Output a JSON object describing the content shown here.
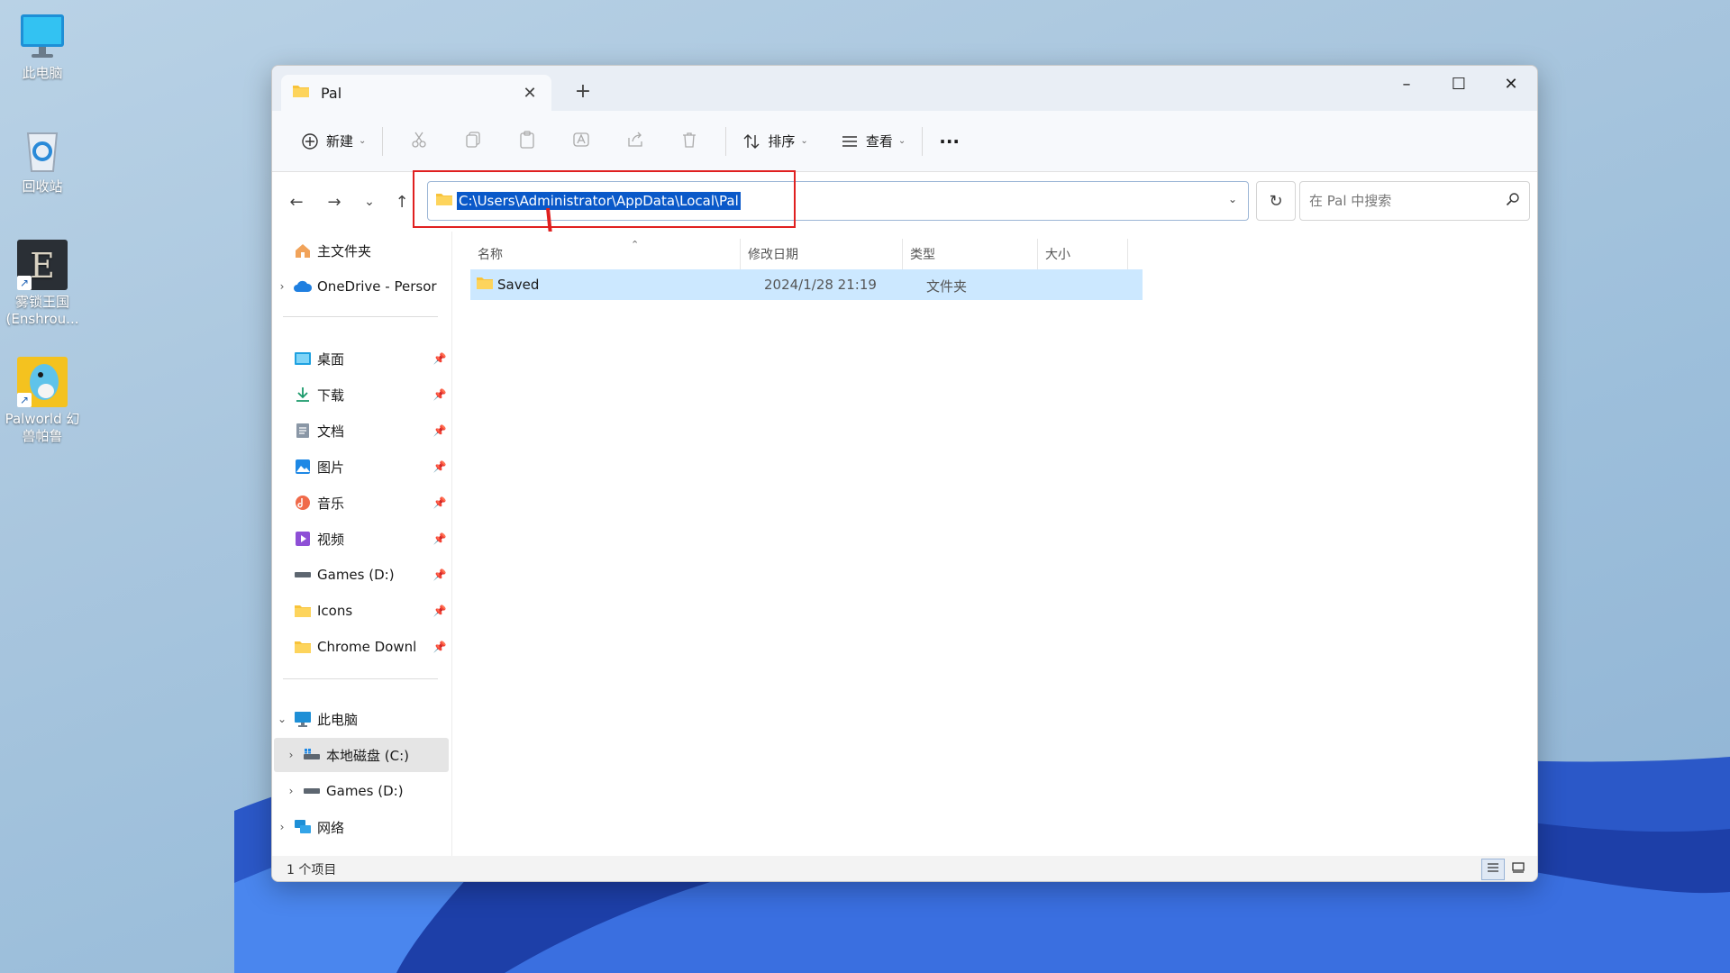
{
  "desktop": {
    "icons": [
      {
        "label": "此电脑",
        "icon": "monitor-icon"
      },
      {
        "label": "回收站",
        "icon": "recycle-bin-icon"
      },
      {
        "label": "雾锁王国 (Enshrou...",
        "icon": "enshrouded-game-icon"
      },
      {
        "label": "Palworld 幻兽帕鲁",
        "icon": "palworld-game-icon"
      }
    ]
  },
  "window": {
    "tab_title": "Pal",
    "new_tab": "+",
    "controls": {
      "minimize": "–",
      "maximize": "☐",
      "close": "✕"
    }
  },
  "toolbar": {
    "new_label": "新建",
    "sort_label": "排序",
    "view_label": "查看",
    "more_label": "···"
  },
  "address_bar": {
    "path": "C:\\Users\\Administrator\\AppData\\Local\\Pal",
    "search_placeholder": "在 Pal 中搜索"
  },
  "sidebar": {
    "home": "主文件夹",
    "onedrive": "OneDrive - Persor",
    "quick_access": [
      {
        "label": "桌面",
        "icon": "desktop-icon"
      },
      {
        "label": "下载",
        "icon": "download-icon"
      },
      {
        "label": "文档",
        "icon": "document-icon"
      },
      {
        "label": "图片",
        "icon": "pictures-icon"
      },
      {
        "label": "音乐",
        "icon": "music-icon"
      },
      {
        "label": "视频",
        "icon": "video-icon"
      },
      {
        "label": "Games (D:)",
        "icon": "drive-icon"
      },
      {
        "label": "Icons",
        "icon": "folder-icon"
      },
      {
        "label": "Chrome Downl",
        "icon": "folder-icon"
      }
    ],
    "this_pc": "此电脑",
    "drive_c": "本地磁盘 (C:)",
    "drive_d": "Games (D:)",
    "network": "网络"
  },
  "file_list": {
    "columns": [
      "名称",
      "修改日期",
      "类型",
      "大小"
    ],
    "rows": [
      {
        "name": "Saved",
        "modified": "2024/1/28 21:19",
        "type": "文件夹",
        "size": ""
      }
    ]
  },
  "status": {
    "count": "1 个项目"
  },
  "colors": {
    "annotation_red": "#e02020",
    "selection_blue": "#0a59c9",
    "row_highlight": "#cce8ff",
    "folder_yellow": "#f8c33a"
  }
}
